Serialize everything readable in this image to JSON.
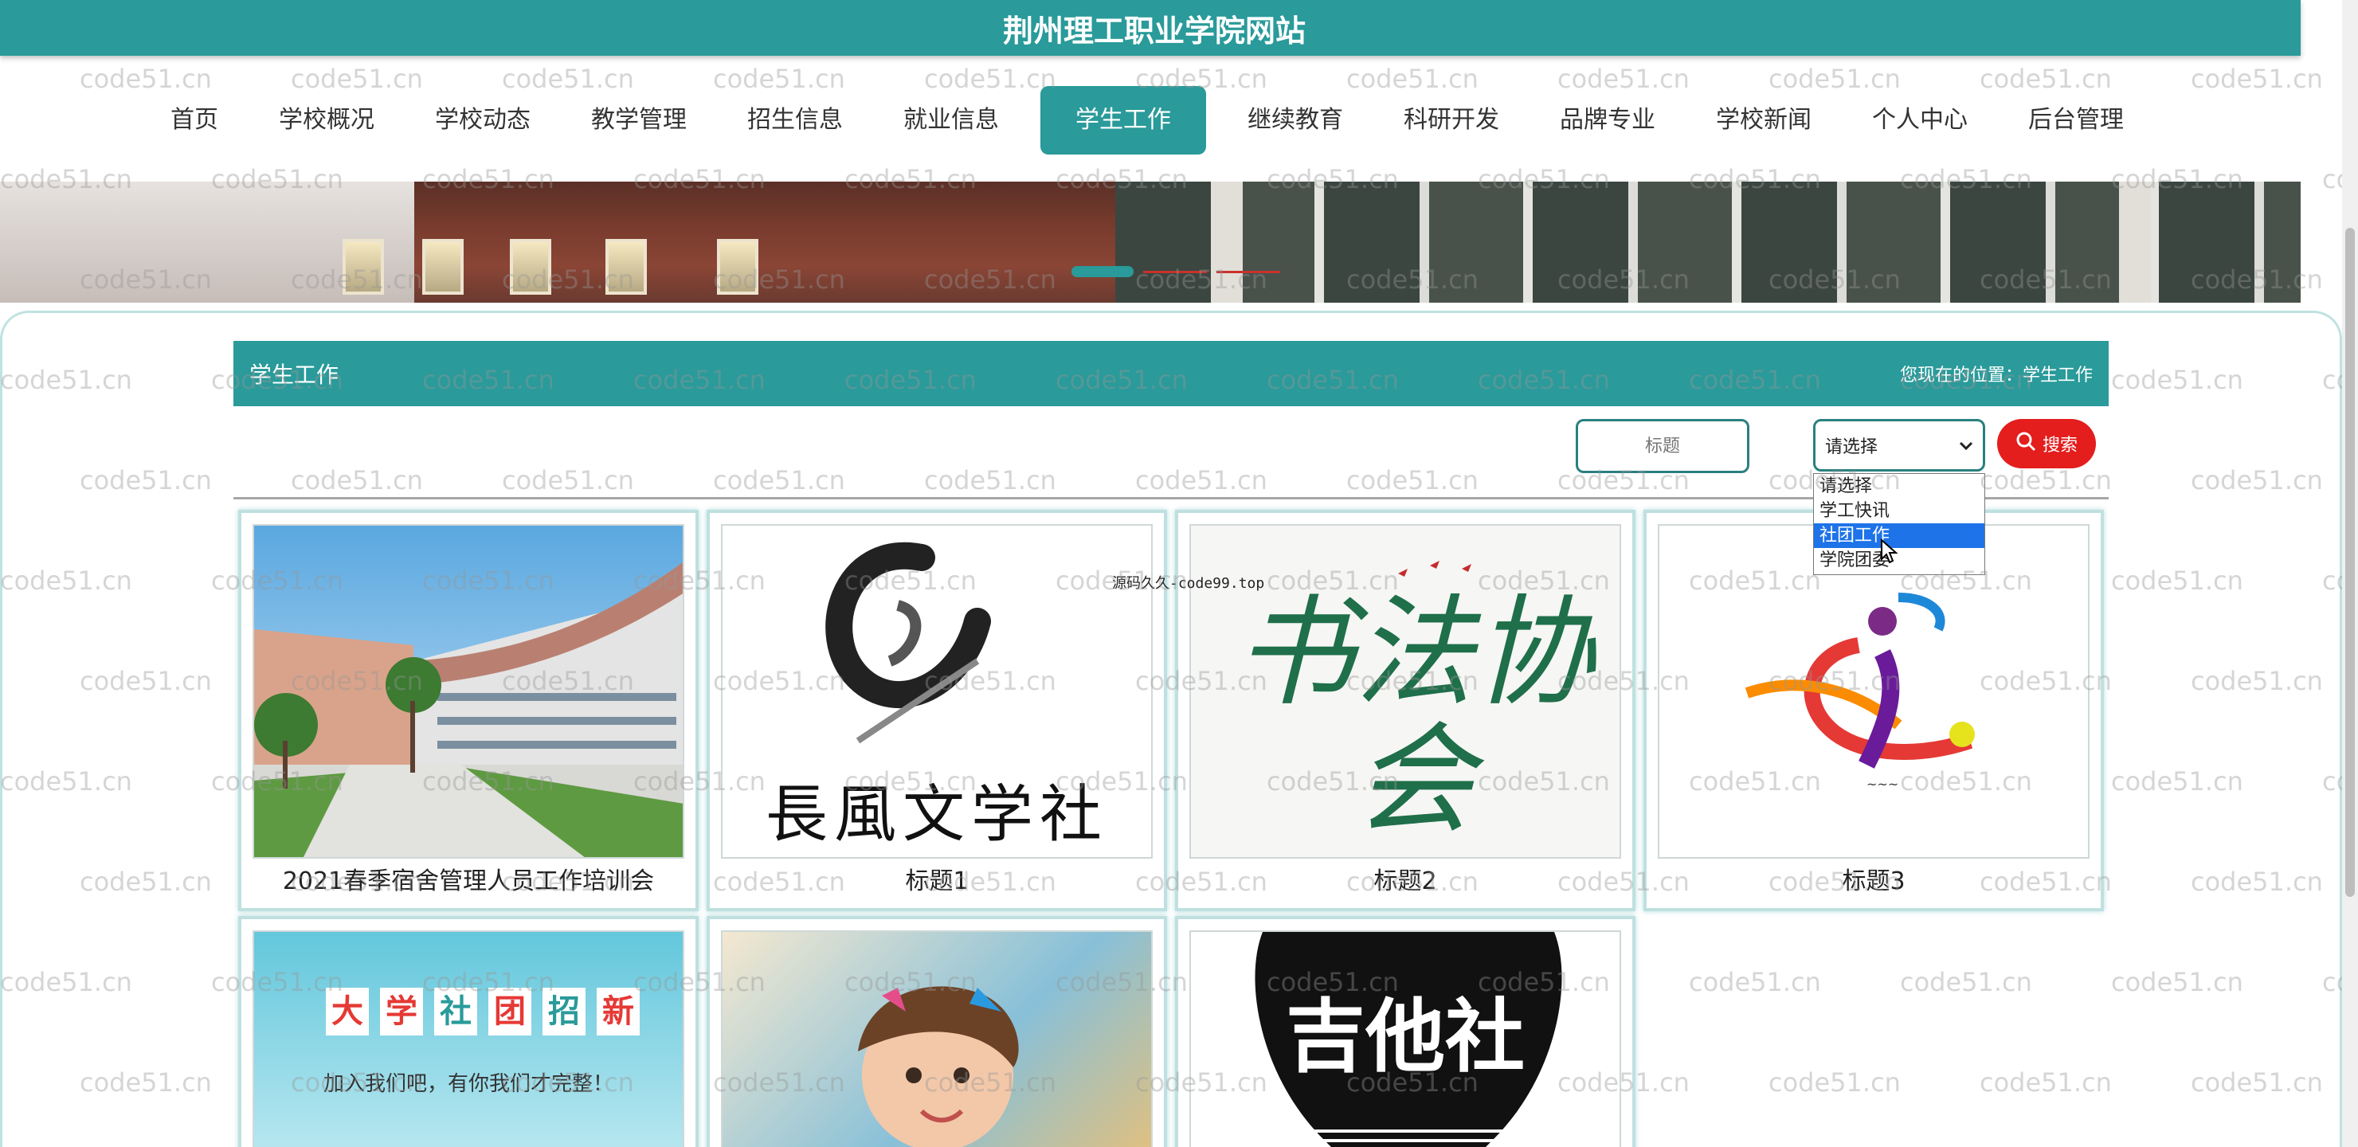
{
  "header": {
    "title": "荆州理工职业学院网站"
  },
  "nav": {
    "items": [
      "首页",
      "学校概况",
      "学校动态",
      "教学管理",
      "招生信息",
      "就业信息",
      "学生工作",
      "继续教育",
      "科研开发",
      "品牌专业",
      "学校新闻",
      "个人中心",
      "后台管理"
    ],
    "active_index": 6
  },
  "section": {
    "title": "学生工作",
    "crumb_label": "您现在的位置：",
    "crumb_value": "学生工作"
  },
  "search": {
    "title_placeholder": "标题",
    "select_value": "请选择",
    "button_label": "搜索",
    "dropdown_options": [
      "请选择",
      "学工快讯",
      "社团工作",
      "学院团委"
    ],
    "highlighted_option": "社团工作"
  },
  "overlay_text": "源码久久-code99.top",
  "watermark": "code51.cn",
  "cards": [
    {
      "caption": "2021春季宿舍管理人员工作培训会",
      "image": "campus-building-photo"
    },
    {
      "caption": "标题1",
      "image": "changfeng-literature-club-logo",
      "image_text": "長風文学社"
    },
    {
      "caption": "标题2",
      "image": "calligraphy-association-logo",
      "image_text": "书法协会"
    },
    {
      "caption": "标题3",
      "image": "sports-figure-logo"
    },
    {
      "caption": "",
      "image": "club-recruitment-banner",
      "image_text": [
        "大",
        "学",
        "社",
        "团",
        "招",
        "新"
      ],
      "image_subtext": "加入我们吧，有你我们才完整！"
    },
    {
      "caption": "",
      "image": "girl-face-paint-photo"
    },
    {
      "caption": "",
      "image": "guitar-club-logo",
      "image_text": "吉他社"
    }
  ],
  "colors": {
    "primary": "#2a9a9a",
    "search_button": "#e41d1d",
    "dropdown_highlight": "#1e73e8"
  }
}
